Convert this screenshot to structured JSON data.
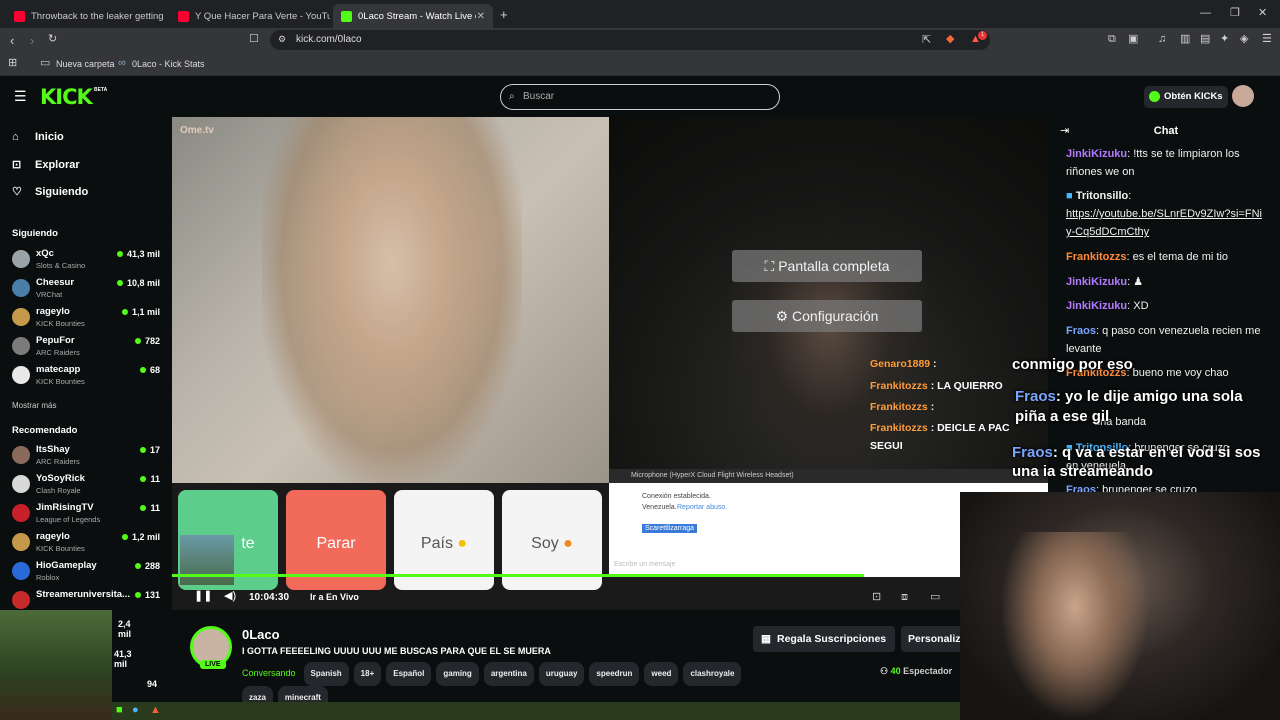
{
  "browser": {
    "tabs": [
      {
        "title": "Throwback to the leaker getting arre",
        "fav": "youtube-icon"
      },
      {
        "title": "Y Que Hacer Para Verte - YouTube",
        "fav": "youtube-icon"
      },
      {
        "title": "0Laco Stream - Watch Live on",
        "fav": "kick-icon"
      }
    ],
    "url": "kick.com/0laco",
    "bookmarks": [
      {
        "label": "Nueva carpeta"
      },
      {
        "label": "0Laco - Kick Stats"
      }
    ],
    "brave_badge": "1"
  },
  "header": {
    "logo": "KICK",
    "beta": "BETA",
    "search_placeholder": "Buscar",
    "kicks_button": "Obtén KICKs"
  },
  "sidebar": {
    "nav": [
      {
        "label": "Inicio",
        "icon": "home-icon"
      },
      {
        "label": "Explorar",
        "icon": "compass-icon"
      },
      {
        "label": "Siguiendo",
        "icon": "heart-icon"
      }
    ],
    "following_title": "Siguiendo",
    "following": [
      {
        "name": "xQc",
        "game": "Slots & Casino",
        "viewers": "41,3 mil",
        "color": "#9aa3a8"
      },
      {
        "name": "Cheesur",
        "game": "VRChat",
        "viewers": "10,8 mil",
        "color": "#4a7da8"
      },
      {
        "name": "rageylo",
        "game": "KICK Bounties",
        "viewers": "1,1 mil",
        "color": "#c49a4a"
      },
      {
        "name": "PepuFor",
        "game": "ARC Raiders",
        "viewers": "782",
        "color": "#7b7b7b"
      },
      {
        "name": "matecapp",
        "game": "KICK Bounties",
        "viewers": "68",
        "color": "#e8e8e8"
      }
    ],
    "show_more": "Mostrar más",
    "recommended_title": "Recomendado",
    "recommended": [
      {
        "name": "ItsShay",
        "game": "ARC Raiders",
        "viewers": "17",
        "color": "#8a6a5a"
      },
      {
        "name": "YoSoyRick",
        "game": "Clash Royale",
        "viewers": "11",
        "color": "#d8d8d8"
      },
      {
        "name": "JimRisingTV",
        "game": "League of Legends",
        "viewers": "11",
        "color": "#c8202a"
      },
      {
        "name": "rageylo",
        "game": "KICK Bounties",
        "viewers": "1,2 mil",
        "color": "#c49a4a"
      },
      {
        "name": "HioGameplay",
        "game": "Roblox",
        "viewers": "288",
        "color": "#2a6ad8"
      },
      {
        "name": "Streameruniversita...",
        "game": "",
        "viewers": "131",
        "color": "#c82a2a"
      }
    ],
    "extra_viewers": [
      "2,4 mil",
      "41,3 mil",
      "94"
    ]
  },
  "video": {
    "watermark": "Ome.tv",
    "overlay_buttons": [
      "Pantalla completa",
      "Configuración"
    ],
    "overlay_chat": [
      {
        "user": "Genaro1889",
        "msg": ":"
      },
      {
        "user": "Frankitozzs",
        "msg": ": LA QUIERRO"
      },
      {
        "user": "Frankitozzs",
        "msg": ":"
      },
      {
        "user": "Frankitozzs",
        "msg": ": DEICLE A PAC"
      },
      {
        "user": "",
        "msg": "SEGUI"
      }
    ],
    "mic_label": "Microphone (HyperX Cloud Flight Wireless Headset)",
    "ome_buttons": [
      {
        "label": "te",
        "color": "#5ccd8a"
      },
      {
        "label": "Parar",
        "color": "#f26a5a"
      },
      {
        "label": "País",
        "color": "#f2f2f2"
      },
      {
        "label": "Soy",
        "color": "#f2f2f2"
      }
    ],
    "ome_status": "Conexión establecida.",
    "ome_country": "Venezuela.",
    "ome_report": "Reportar abuso.",
    "ome_name": "Scarettlizarraga",
    "ome_input_placeholder": "Escribe un mensaje",
    "time": "10:04:30",
    "live_link": "Ir a En Vivo",
    "progress": 0.79
  },
  "stream": {
    "channel": "0Laco",
    "title": "I GOTTA FEEEELING UUUU UUU ME BUSCAS PARA QUE EL SE MUERA",
    "live": "LIVE",
    "category": "Conversando",
    "tags": [
      "Spanish",
      "18+",
      "Español",
      "gaming",
      "argentina",
      "uruguay",
      "speedrun",
      "weed",
      "clashroyale",
      "zaza",
      "minecraft"
    ],
    "gift_button": "Regala Suscripciones",
    "personalize_button": "Personaliz",
    "viewers": "40",
    "viewers_label": "Espectador"
  },
  "chat": {
    "title": "Chat",
    "messages": [
      {
        "user": "JinkiKizuku",
        "text": " !tts se te limpiaron los riñones we on",
        "color": "#b57bff"
      },
      {
        "user": "Tritonsillo",
        "text": "https://youtube.be/SLnrEDv9ZIw?si=FNiy-Cq5dDCmCthy",
        "color": "#4ab8ff"
      },
      {
        "user": "Frankitozzs",
        "text": " es el tema de mi tio",
        "color": "#ff8a3a"
      },
      {
        "user": "JinkiKizuku",
        "text": "",
        "color": "#b57bff"
      },
      {
        "user": "JinkiKizuku",
        "text": " XD",
        "color": "#b57bff"
      },
      {
        "user": "Fraos",
        "text": " q paso con venezuela recien me levante",
        "color": "#7aa6ff"
      },
      {
        "user": "Frankitozzs",
        "text": " bueno me voy chao",
        "color": "#ff8a3a"
      },
      {
        "user": "",
        "text": "una banda",
        "color": "#fff"
      },
      {
        "user": "Tritonsillo",
        "text": " brunenger se cruzo",
        "color": "#4ab8ff"
      },
      {
        "user": "",
        "text": "en veneuela",
        "color": "#fff"
      },
      {
        "user": "Fraos",
        "text": " brunenger se cruzo",
        "color": "#7aa6ff"
      }
    ]
  },
  "big_overlay": [
    {
      "user": "Fraos",
      "text": "conmigo por eso"
    },
    {
      "user": "Fraos",
      "text": ": yo le dije amigo una sola piña a ese gil"
    },
    {
      "user": "Fraos",
      "text": ": q va a estar en el vod si sos una ia streameando"
    }
  ]
}
